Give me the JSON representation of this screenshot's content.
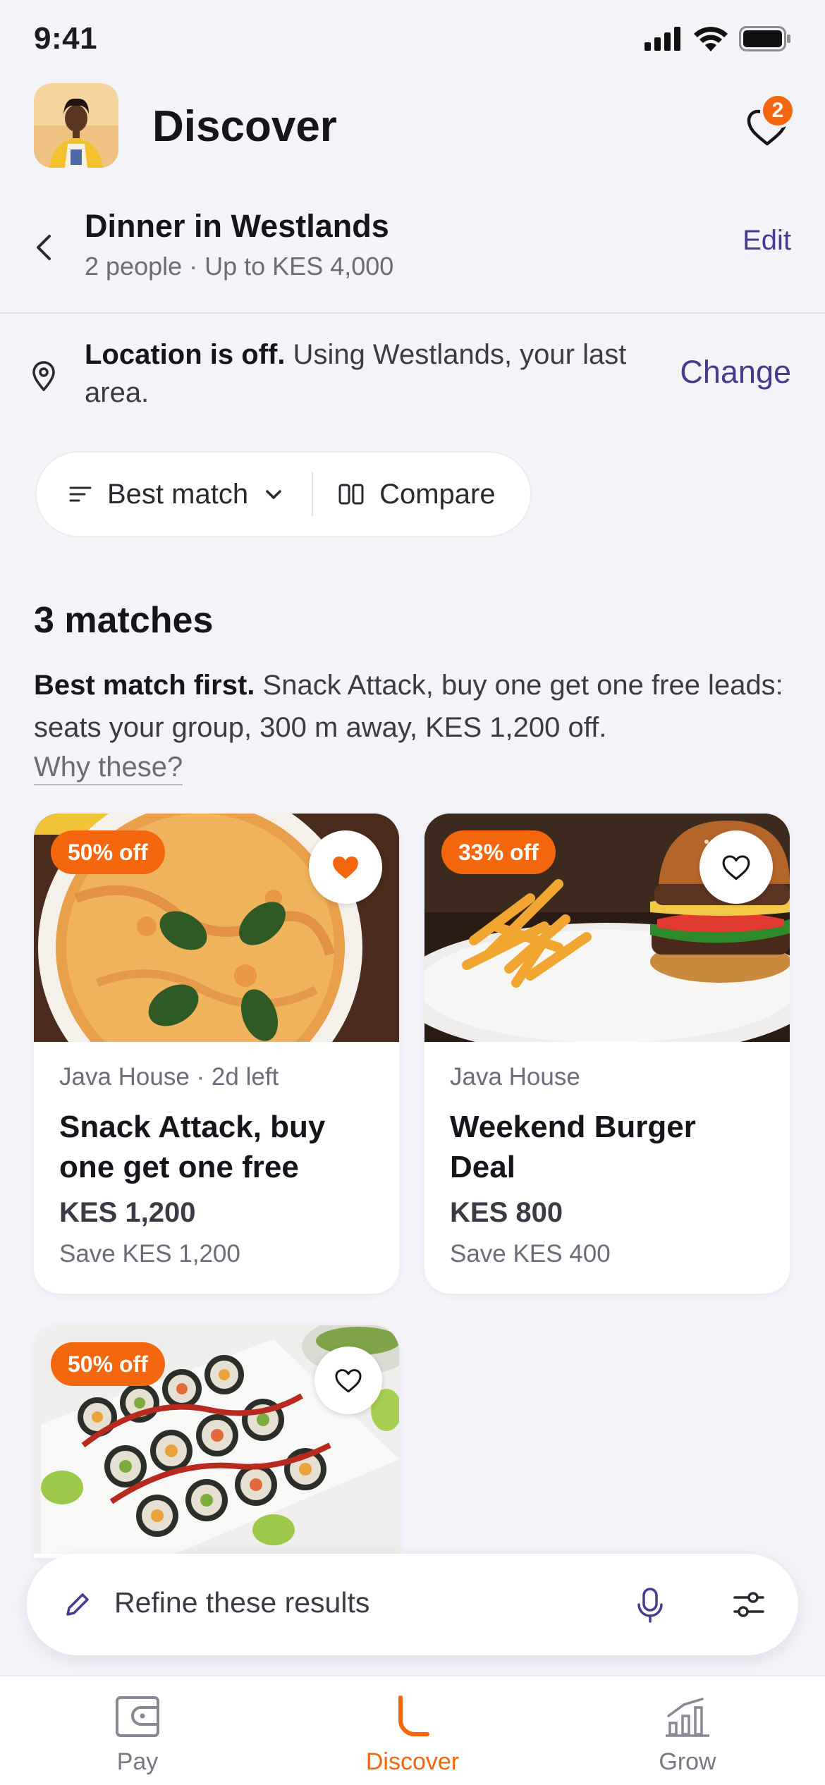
{
  "status_bar": {
    "time": "9:41"
  },
  "header": {
    "title": "Discover",
    "favorites_count": "2"
  },
  "context": {
    "title": "Dinner in Westlands",
    "subtitle": "2 people · Up to KES 4,000",
    "edit_label": "Edit"
  },
  "location": {
    "bold": "Location is off.",
    "text": " Using Westlands, your last area.",
    "change_label": "Change"
  },
  "controls": {
    "sort_label": "Best match",
    "compare_label": "Compare"
  },
  "results": {
    "count_label": "3 matches",
    "explain_bold": "Best match first.",
    "explain_text": " Snack Attack, buy one get one free leads: seats your group, 300 m away, KES 1,200 off.",
    "why_label": "Why these?"
  },
  "cards": [
    {
      "discount": "50% off",
      "meta": "Java House · 2d left",
      "title": "Snack Attack, buy one get one free",
      "price": "KES 1,200",
      "save": "Save KES 1,200",
      "favorited": true
    },
    {
      "discount": "33% off",
      "meta": "Java House",
      "title": "Weekend Burger Deal",
      "price": "KES 800",
      "save": "Save KES 400",
      "favorited": false
    },
    {
      "discount": "50% off",
      "favorited": false
    }
  ],
  "refine": {
    "placeholder": "Refine these results"
  },
  "tabs": [
    {
      "label": "Pay",
      "icon": "wallet-icon"
    },
    {
      "label": "Discover",
      "icon": "discover-icon"
    },
    {
      "label": "Grow",
      "icon": "growth-chart-icon"
    }
  ],
  "colors": {
    "accent": "#f5670f",
    "link": "#4a3a8f",
    "background": "#f4f3f8"
  }
}
